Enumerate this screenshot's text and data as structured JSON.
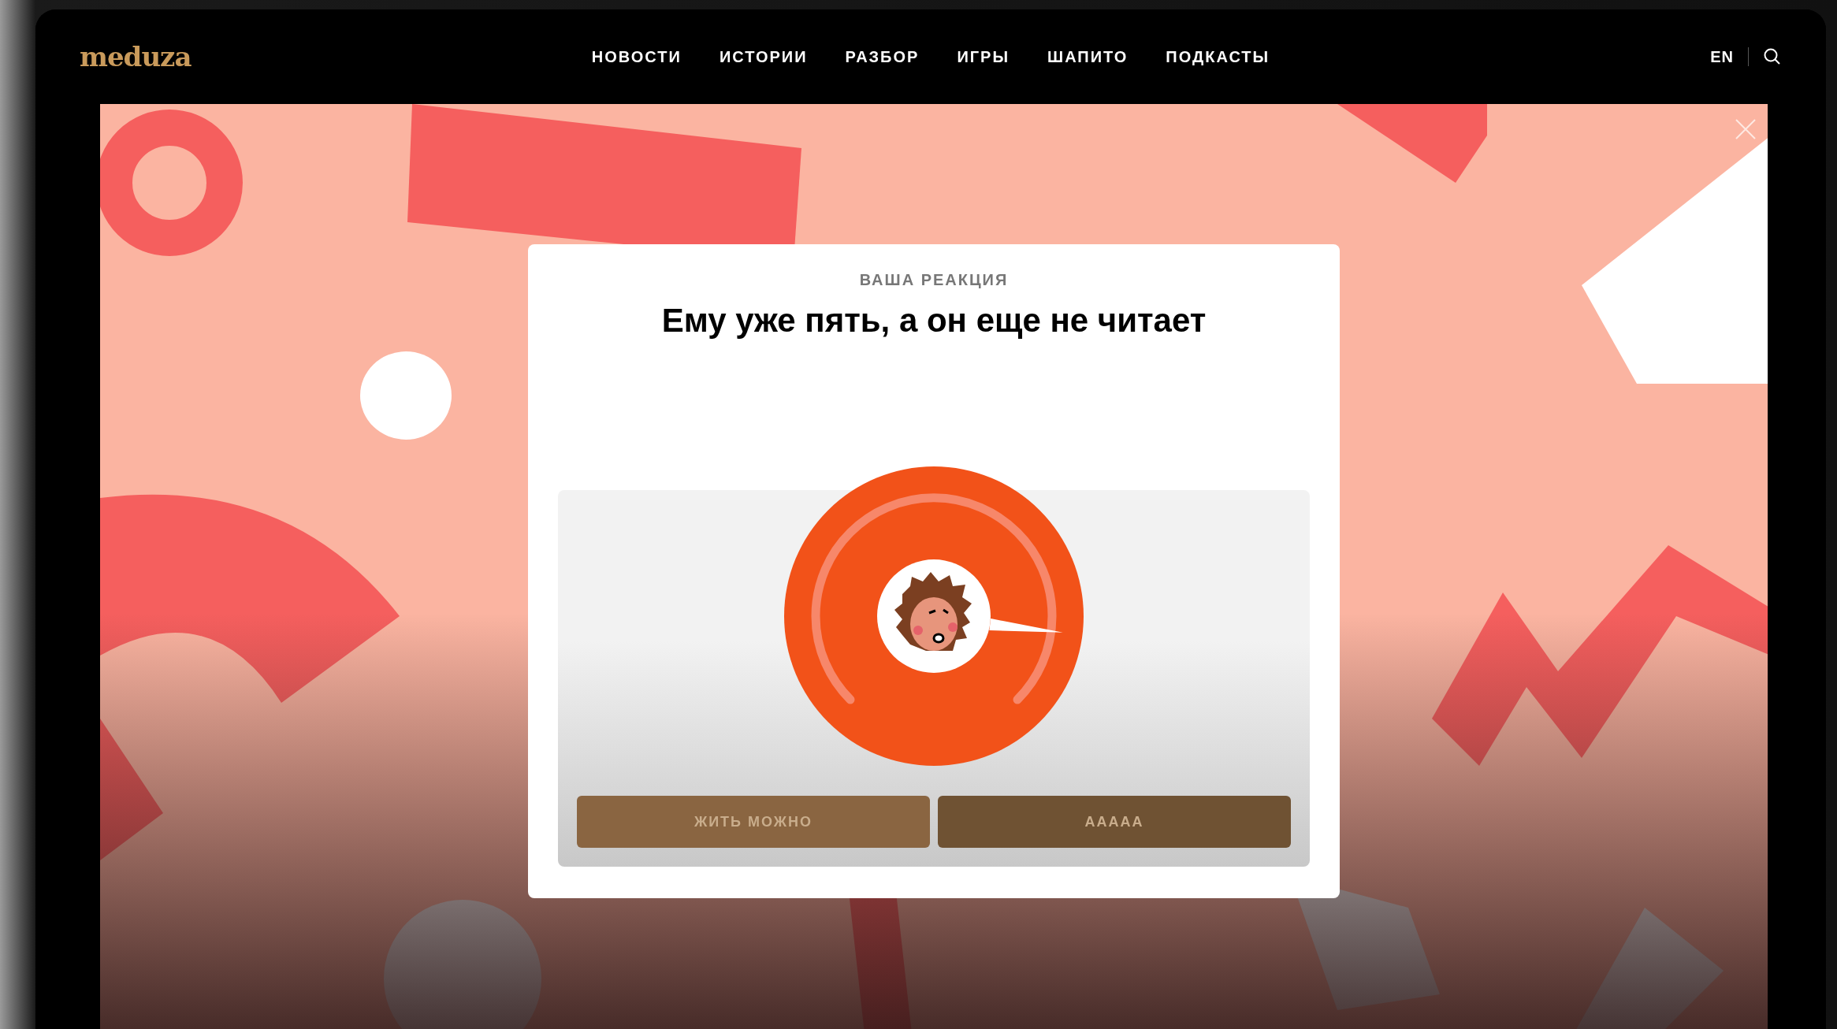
{
  "header": {
    "logo": "meduza",
    "nav": [
      "НОВОСТИ",
      "ИСТОРИИ",
      "РАЗБОР",
      "ИГРЫ",
      "ШАПИТО",
      "ПОДКАСТЫ"
    ],
    "language_link": "EN"
  },
  "modal": {
    "eyebrow": "ВАША РЕАКЦИЯ",
    "question": "Ему уже пять, а он еще не читает",
    "dial": {
      "level": 0.86
    },
    "answers": [
      {
        "label": "ЖИТЬ МОЖНО",
        "color": "#8a6541"
      },
      {
        "label": "ААААА",
        "color": "#6f5233"
      }
    ]
  }
}
